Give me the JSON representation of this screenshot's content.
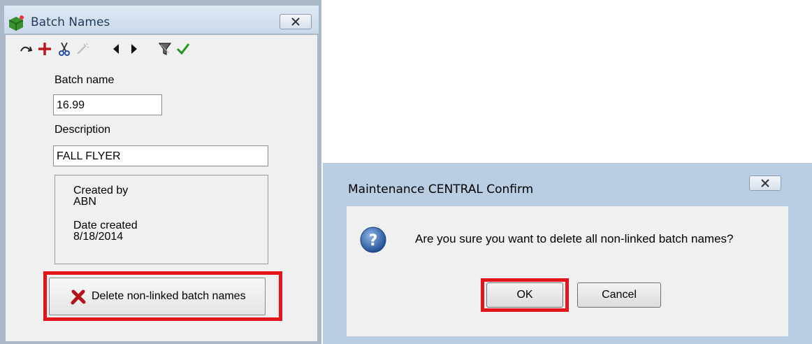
{
  "batch_window": {
    "title": "Batch Names",
    "toolbar": {
      "icons": [
        "redo-icon",
        "add-icon",
        "cut-icon",
        "wand-icon",
        "previous-icon",
        "next-icon",
        "filter-icon",
        "accept-icon"
      ]
    },
    "batch_name_label": "Batch name",
    "batch_name_value": "16.99",
    "description_label": "Description",
    "description_value": "FALL FLYER",
    "created_by_label": "Created by",
    "created_by_value": "ABN",
    "date_created_label": "Date created",
    "date_created_value": "8/18/2014",
    "delete_button_label": "Delete non-linked batch names"
  },
  "confirm_dialog": {
    "title": "Maintenance CENTRAL Confirm",
    "message": "Are you sure you want to delete all non-linked batch names?",
    "ok_label": "OK",
    "cancel_label": "Cancel"
  },
  "colors": {
    "highlight": "#e3141b",
    "delete_icon": "#b3131b",
    "accept_icon": "#1f9a1f",
    "question_icon": "#2a5a9c"
  }
}
